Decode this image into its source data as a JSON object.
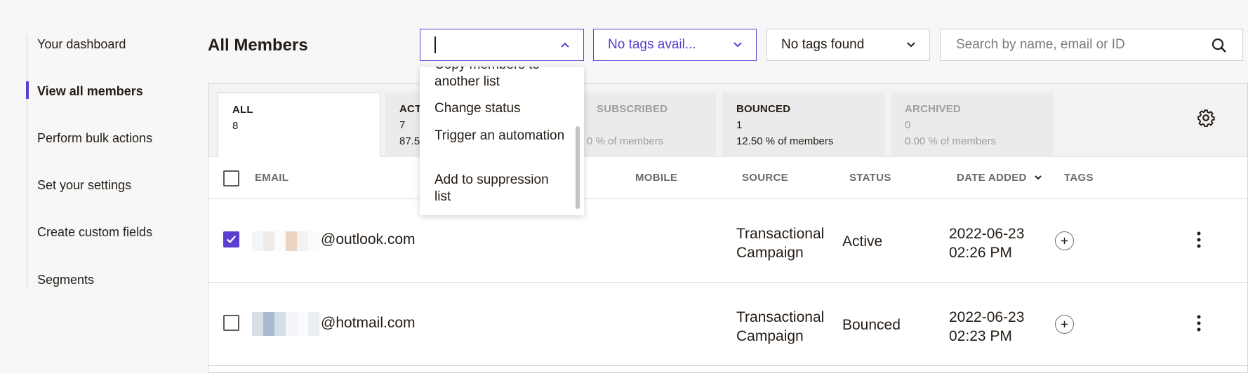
{
  "sidebar": {
    "items": [
      {
        "label": "Your dashboard"
      },
      {
        "label": "View all members"
      },
      {
        "label": "Perform bulk actions"
      },
      {
        "label": "Set your settings"
      },
      {
        "label": "Create custom fields"
      },
      {
        "label": "Segments"
      }
    ],
    "active": "View all members"
  },
  "header": {
    "title": "All Members",
    "action_dropdown_value": "",
    "tags_dropdown_1": "No tags avail...",
    "tags_dropdown_2": "No tags found",
    "search_placeholder": "Search by name, email or ID"
  },
  "action_menu": {
    "items": [
      {
        "label": "Copy members to another list"
      },
      {
        "label": "Change status"
      },
      {
        "label": "Trigger an automation"
      },
      {
        "label": "Add to suppression list"
      }
    ]
  },
  "tabs": [
    {
      "label": "ALL",
      "count": "8",
      "percent": ""
    },
    {
      "label": "ACT",
      "count": "7",
      "percent": "87.5"
    },
    {
      "label": "SUBSCRIBED",
      "count": "",
      "percent": "0 % of members"
    },
    {
      "label": "BOUNCED",
      "count": "1",
      "percent": "12.50 % of members"
    },
    {
      "label": "ARCHIVED",
      "count": "0",
      "percent": "0.00 % of members"
    }
  ],
  "table": {
    "columns": [
      "EMAIL",
      "MOBILE",
      "SOURCE",
      "STATUS",
      "DATE ADDED",
      "TAGS"
    ],
    "rows": [
      {
        "email": "@outlook.com",
        "source": "Transactional Campaign",
        "source_l1": "Transactional",
        "source_l2": "Campaign",
        "status": "Active",
        "date_l1": "2022-06-23",
        "date_l2": "02:26 PM",
        "checked": true
      },
      {
        "email": "@hotmail.com",
        "source": "Transactional Campaign",
        "source_l1": "Transactional",
        "source_l2": "Campaign",
        "status": "Bounced",
        "date_l1": "2022-06-23",
        "date_l2": "02:23 PM",
        "checked": false
      }
    ]
  },
  "colors": {
    "accent": "#5a3fd0",
    "text": "#241c15",
    "muted": "#9e9e9e"
  }
}
